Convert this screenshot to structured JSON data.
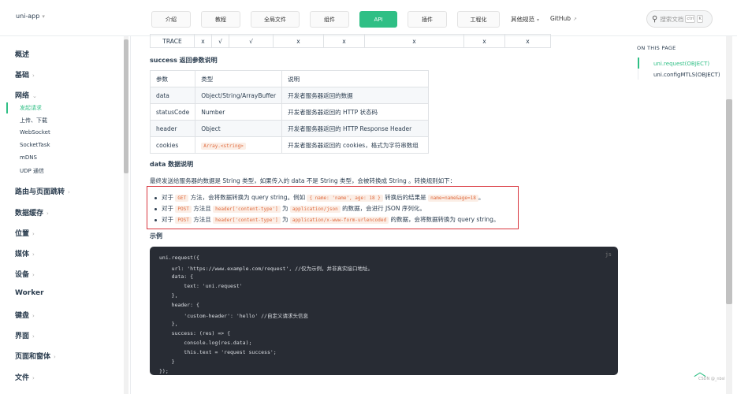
{
  "topbar": {
    "brand": "uni-app",
    "nav": [
      "介绍",
      "教程",
      "全局文件",
      "组件",
      "API",
      "插件",
      "工程化"
    ],
    "nav_active": "API",
    "other": "其他规范",
    "github": "GitHub",
    "search_placeholder": "搜索文档",
    "kbd1": "ctrl",
    "kbd2": "K"
  },
  "sidebar": {
    "items": [
      "概述",
      "基础",
      "网络",
      "路由与页面跳转",
      "数据缓存",
      "位置",
      "媒体",
      "设备",
      "Worker",
      "键盘",
      "界面",
      "页面和窗体",
      "文件"
    ],
    "network_children": [
      "发起请求",
      "上传、下载",
      "WebSocket",
      "SocketTask",
      "mDNS",
      "UDP 通信"
    ]
  },
  "content": {
    "trace_row": [
      "TRACE",
      "x",
      "√",
      "√",
      "x",
      "x",
      "x",
      "x",
      "x"
    ],
    "success_heading": "success 返回参数说明",
    "table_headers": [
      "参数",
      "类型",
      "说明"
    ],
    "table_rows": [
      {
        "param": "data",
        "type": "Object/String/ArrayBuffer",
        "desc": "开发者服务器返回的数据"
      },
      {
        "param": "statusCode",
        "type": "Number",
        "desc": "开发者服务器返回的 HTTP 状态码"
      },
      {
        "param": "header",
        "type": "Object",
        "desc": "开发者服务器返回的 HTTP Response Header"
      },
      {
        "param": "cookies",
        "type": "Array.<string>",
        "desc": "开发者服务器返回的 cookies，格式为字符串数组"
      }
    ],
    "data_heading": "data 数据说明",
    "data_para": "最终发送给服务器的数据是 String 类型，如果传入的 data 不是 String 类型，会被转换成 String 。转换规则如下：",
    "bullets": {
      "b1_a": "对于",
      "b1_code1": "GET",
      "b1_b": "方法，会将数据转换为 query string。例如",
      "b1_code2": "{ name: 'name', age: 18 }",
      "b1_c": "转换后的结果是",
      "b1_code3": "name=name&age=18",
      "b1_d": "。",
      "b2_a": "对于",
      "b2_code1": "POST",
      "b2_b": "方法且",
      "b2_code2": "header['content-type']",
      "b2_c": "为",
      "b2_code3": "application/json",
      "b2_d": "的数据，会进行 JSON 序列化。",
      "b3_a": "对于",
      "b3_code1": "POST",
      "b3_b": "方法且",
      "b3_code2": "header['content-type']",
      "b3_c": "为",
      "b3_code3": "application/x-www-form-urlencoded",
      "b3_d": "的数据，会将数据转换为 query string。"
    },
    "example_heading": "示例",
    "code_lines": [
      "uni.request({",
      "    url: 'https://www.example.com/request', //仅为示例，并非真实接口地址。",
      "    data: {",
      "        text: 'uni.request'",
      "    },",
      "    header: {",
      "        'custom-header': 'hello' //自定义请求头信息",
      "    },",
      "    success: (res) => {",
      "        console.log(res.data);",
      "        this.text = 'request success';",
      "    }",
      "});"
    ],
    "code_lang": "js"
  },
  "toc": {
    "title": "ON THIS PAGE",
    "items": [
      "uni.request(OBJECT)",
      "uni.configMTLS(OBJECT)"
    ]
  },
  "watermark": "CSDN @_nbsl",
  "colors": {
    "accent": "#2fbf85",
    "highlight_box": "#d9363e",
    "code_bg": "#282c34"
  }
}
